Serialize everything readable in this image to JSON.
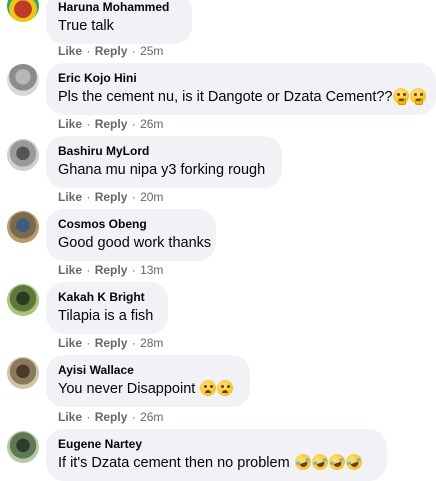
{
  "actions": {
    "like": "Like",
    "reply": "Reply",
    "separator": "·"
  },
  "comments": [
    {
      "name": "Haruna Mohammed",
      "text": "True talk",
      "time": "25m"
    },
    {
      "name": "Eric Kojo Hini",
      "text": "Pls the cement nu, is it Dangote or Dzata Cement??",
      "time": "26m",
      "emojis": [
        "thinking-face-icon",
        "thinking-face-icon"
      ]
    },
    {
      "name": "Bashiru MyLord",
      "text": "Ghana mu nipa y3 forking rough",
      "time": "20m"
    },
    {
      "name": "Cosmos Obeng",
      "text": "Good good work thanks",
      "time": "13m"
    },
    {
      "name": "Kakah K Bright",
      "text": "Tilapia is a fish",
      "time": "28m"
    },
    {
      "name": "Ayisi Wallace",
      "text": "You never Disappoint ",
      "time": "26m",
      "emojis": [
        "sad-face-icon",
        "sad-face-icon"
      ]
    },
    {
      "name": "Eugene Nartey",
      "text": "If it's Dzata cement then no problem ",
      "time": "",
      "emojis": [
        "rofl-icon",
        "rofl-icon",
        "rofl-icon",
        "rofl-icon"
      ]
    }
  ]
}
